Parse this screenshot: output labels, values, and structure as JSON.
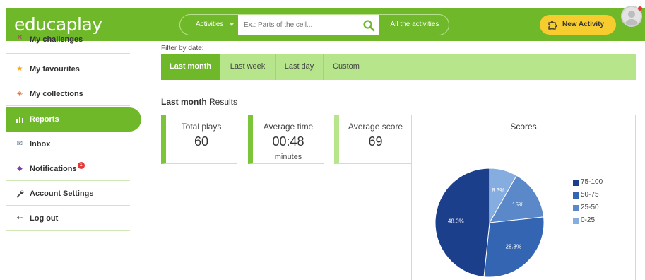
{
  "header": {
    "logo": "educaplay",
    "search": {
      "category": "Activities",
      "placeholder": "Ex.: Parts of the cell...",
      "all_activities": "All the activities"
    },
    "new_activity": "New Activity"
  },
  "sidebar": {
    "items": [
      {
        "label": "My challenges",
        "icon": "challenge-icon"
      },
      {
        "label": "My favourites",
        "icon": "star-icon"
      },
      {
        "label": "My collections",
        "icon": "collection-icon"
      },
      {
        "label": "Reports",
        "icon": "chart-icon",
        "active": true
      },
      {
        "label": "Inbox",
        "icon": "mail-icon"
      },
      {
        "label": "Notifications",
        "icon": "bell-icon",
        "badge": "1"
      },
      {
        "label": "Account Settings",
        "icon": "wrench-icon"
      },
      {
        "label": "Log out",
        "icon": "logout-icon"
      }
    ]
  },
  "filter": {
    "label": "Filter by date:",
    "tabs": [
      "Last month",
      "Last week",
      "Last day",
      "Custom"
    ],
    "active": "Last month"
  },
  "results": {
    "title_bold": "Last month",
    "title_rest": " Results"
  },
  "stats": {
    "total_plays": {
      "label": "Total plays",
      "value": "60"
    },
    "average_time": {
      "label": "Average time",
      "value": "00:48",
      "unit": "minutes"
    },
    "average_score": {
      "label": "Average score",
      "value": "69"
    }
  },
  "chart_data": {
    "type": "pie",
    "title": "Scores",
    "slices": [
      {
        "label": "75-100",
        "value": 48.3,
        "display": "48.3%",
        "color": "#1c3f8c"
      },
      {
        "label": "50-75",
        "value": 28.3,
        "display": "28.3%",
        "color": "#3465b2"
      },
      {
        "label": "25-50",
        "value": 15,
        "display": "15%",
        "color": "#5a88c8"
      },
      {
        "label": "0-25",
        "value": 8.3,
        "display": "8.3%",
        "color": "#86ade0"
      }
    ],
    "legend_placement": "right"
  },
  "colors": {
    "brand_green": "#6fb829",
    "light_green": "#b6e58b",
    "new_activity_yellow": "#f7cc2f"
  }
}
